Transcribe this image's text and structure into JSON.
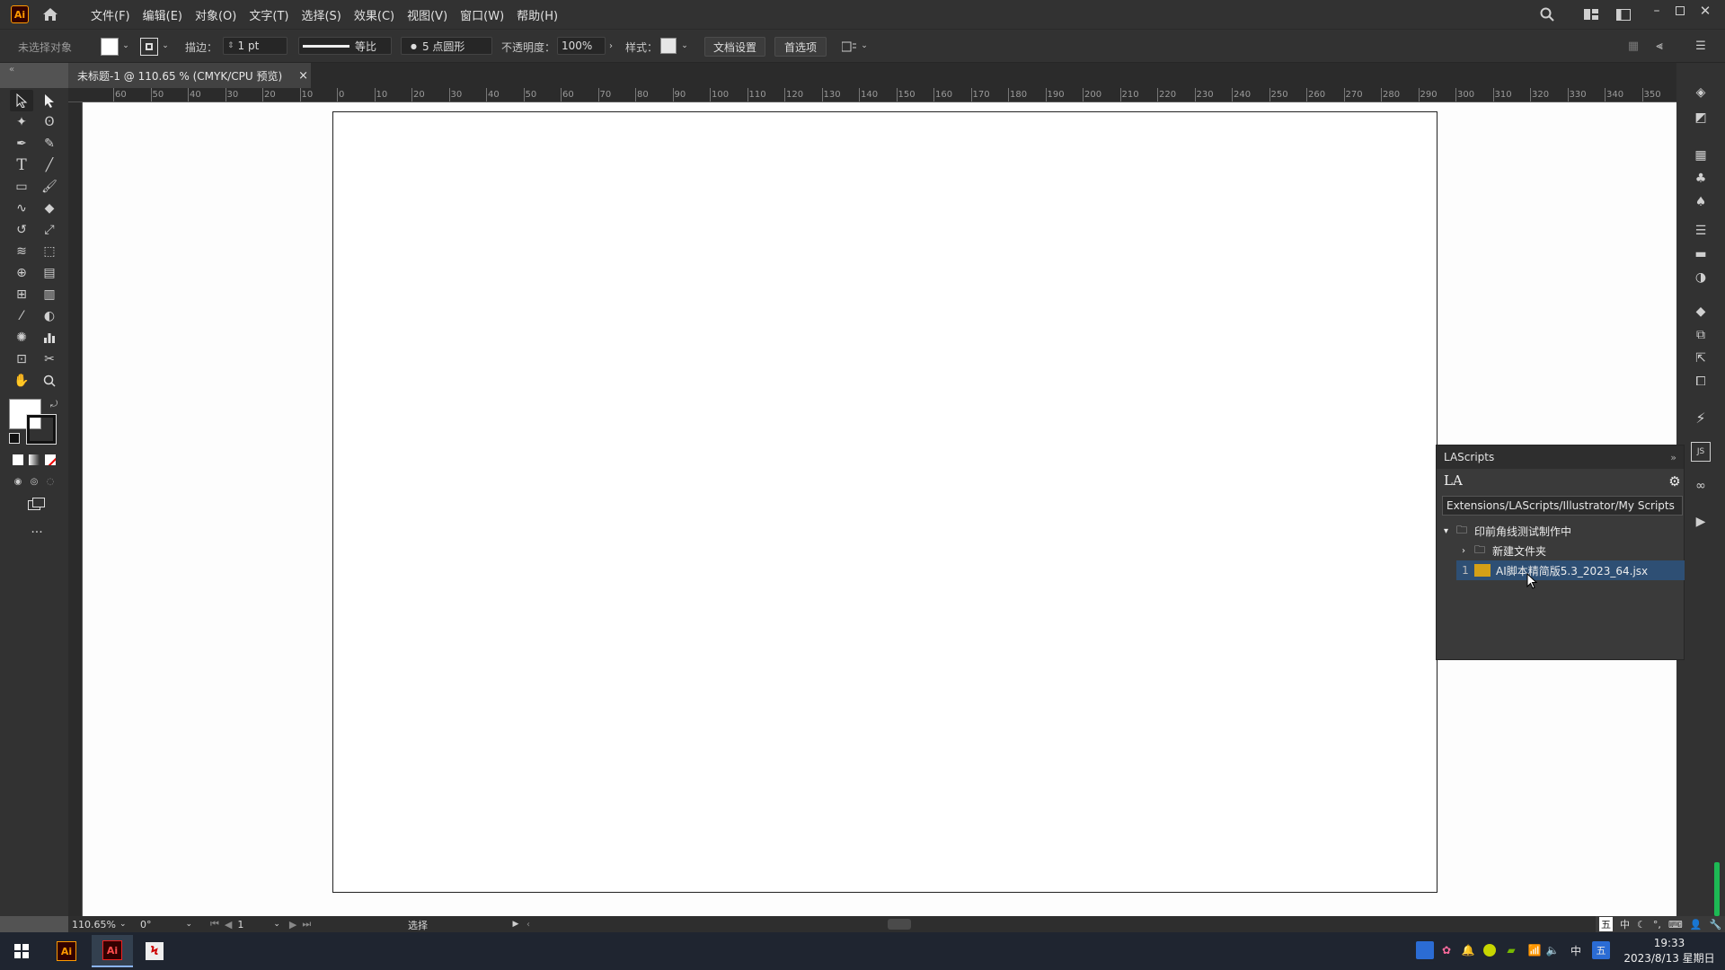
{
  "app": {
    "logo": "Ai"
  },
  "menu": [
    "文件(F)",
    "编辑(E)",
    "对象(O)",
    "文字(T)",
    "选择(S)",
    "效果(C)",
    "视图(V)",
    "窗口(W)",
    "帮助(H)"
  ],
  "control": {
    "selection_label": "未选择对象",
    "stroke_label": "描边：",
    "stroke_value": "1 pt",
    "stroke_profile": "等比",
    "brush": "5 点圆形",
    "opacity_label": "不透明度：",
    "opacity_value": "100%",
    "style_label": "样式：",
    "doc_setup": "文档设置",
    "preferences": "首选项"
  },
  "document": {
    "tab_title": "未标题-1 @ 110.65 % (CMYK/CPU 预览)",
    "close": "×"
  },
  "ruler": {
    "h_ticks": [
      "60",
      "50",
      "40",
      "30",
      "20",
      "10",
      "0",
      "10",
      "20",
      "30",
      "40",
      "50",
      "60",
      "70",
      "80",
      "90",
      "100",
      "110",
      "120",
      "130",
      "140",
      "150",
      "160",
      "170",
      "180",
      "190",
      "200",
      "210",
      "220",
      "230",
      "240",
      "250",
      "260",
      "270",
      "280",
      "290",
      "300",
      "310",
      "320",
      "330",
      "340",
      "350"
    ]
  },
  "lascripts": {
    "title": "LAScripts",
    "logo": "LA",
    "path": "Extensions/LAScripts/Illustrator/My Scripts",
    "tree": [
      {
        "label": "印前角线测试制作中",
        "level": 0,
        "expanded": true
      },
      {
        "label": "新建文件夹",
        "level": 1,
        "expanded": false
      },
      {
        "label": "AI脚本精简版5.3_2023_64.jsx",
        "level": 1,
        "index": "1",
        "selected": true
      }
    ]
  },
  "status": {
    "zoom": "110.65%",
    "rotation": "0°",
    "artboard": "1",
    "mode": "选择"
  },
  "taskbar": {
    "ime_lang": "中",
    "ime_mode": "五",
    "time": "19:33",
    "date": "2023/8/13 星期日"
  },
  "colors": {
    "accent": "#ff9a00",
    "selection": "#2e4f74"
  }
}
